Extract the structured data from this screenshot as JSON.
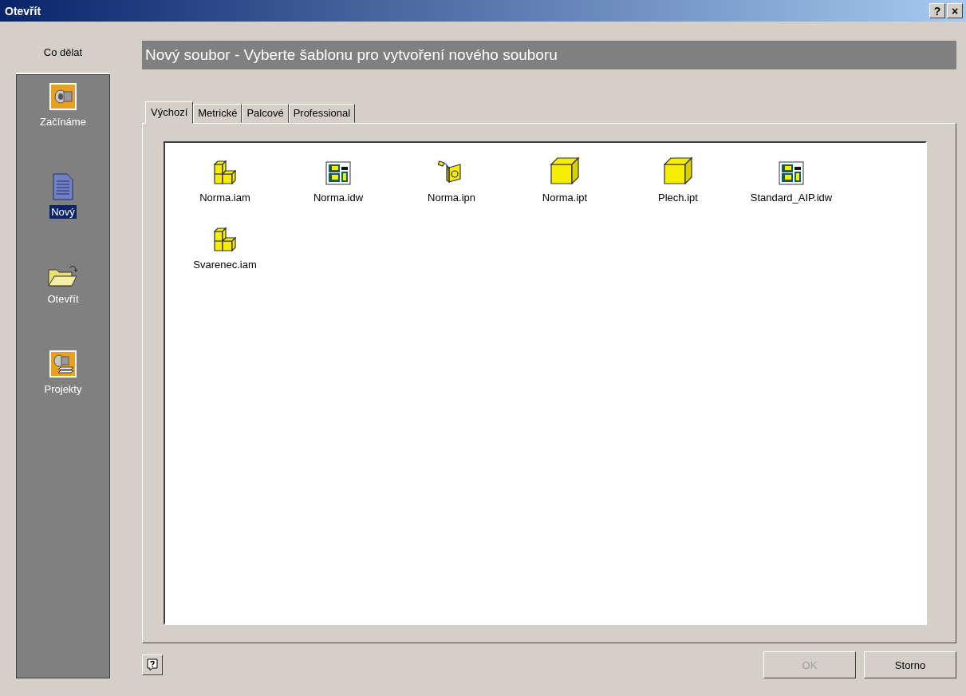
{
  "window": {
    "title": "Otevřít",
    "buttons": [
      {
        "label": "?"
      },
      {
        "label": "×"
      }
    ]
  },
  "sidebar": {
    "heading": "Co dělat",
    "items": [
      {
        "label": "Začínáme",
        "kind": "gear",
        "selected": false
      },
      {
        "label": "Nový",
        "kind": "document",
        "selected": true
      },
      {
        "label": "Otevřít",
        "kind": "folder",
        "selected": false
      },
      {
        "label": "Projekty",
        "kind": "project",
        "selected": false
      }
    ]
  },
  "header": "Nový soubor - Vyberte šablonu pro vytvoření nového souboru",
  "tabs": [
    {
      "label": "Výchozí",
      "selected": true
    },
    {
      "label": "Metrické",
      "selected": false
    },
    {
      "label": "Palcové",
      "selected": false
    },
    {
      "label": "Professional",
      "selected": false
    }
  ],
  "files": [
    {
      "name": "Norma.iam",
      "kind": "assembly"
    },
    {
      "name": "Norma.idw",
      "kind": "drawing"
    },
    {
      "name": "Norma.ipn",
      "kind": "presentation"
    },
    {
      "name": "Norma.ipt",
      "kind": "part"
    },
    {
      "name": "Plech.ipt",
      "kind": "part"
    },
    {
      "name": "Standard_AIP.idw",
      "kind": "drawing"
    },
    {
      "name": "Svarenec.iam",
      "kind": "assembly"
    }
  ],
  "footer": {
    "buttons": [
      {
        "label": "OK",
        "disabled": true
      },
      {
        "label": "Storno",
        "disabled": false
      }
    ]
  }
}
